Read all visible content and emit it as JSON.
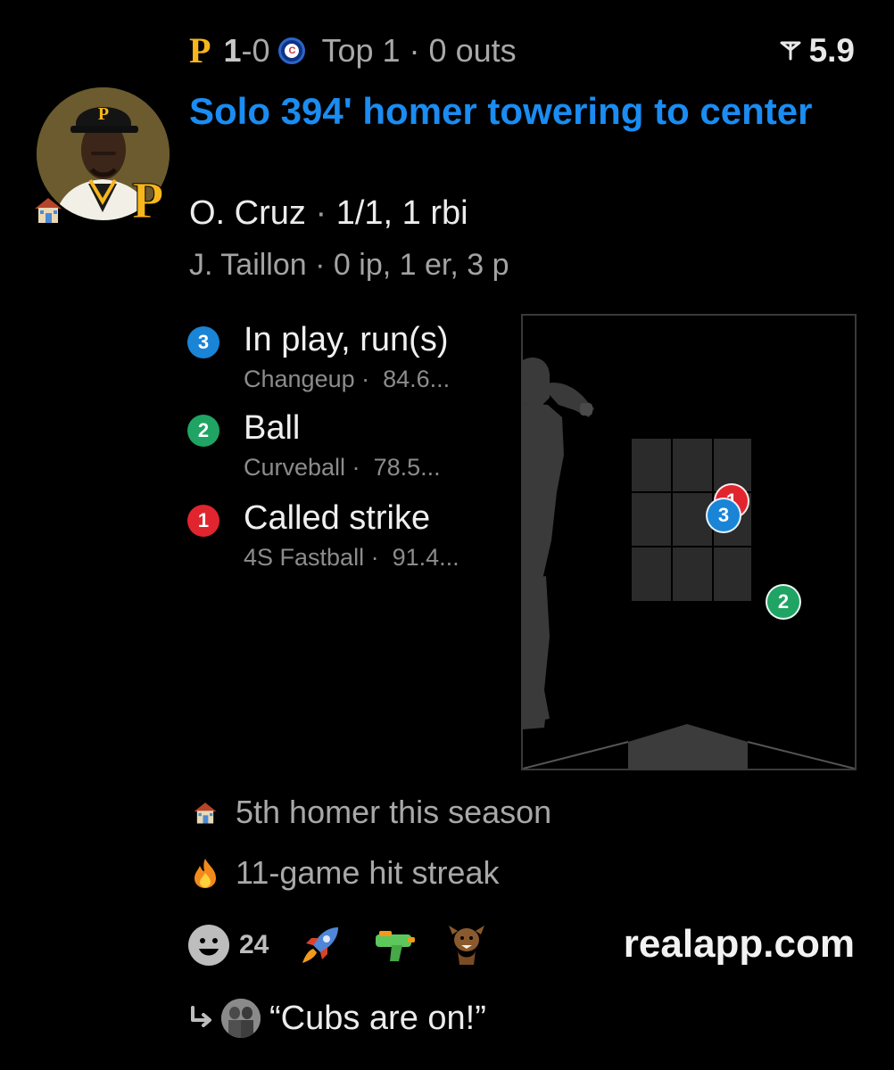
{
  "game": {
    "home_logo": "P",
    "home_score": "1",
    "away_score": "-0",
    "away_logo": "C",
    "inning_status": "Top 1 · 0 outs",
    "rating": "5.9",
    "rating_icon": "flag-icon"
  },
  "play": {
    "headline": "Solo 394' homer towering to center",
    "batter_name": "O. Cruz",
    "batter_stats": "1/1, 1 rbi",
    "pitcher_name": "J. Taillon",
    "pitcher_stats": "0 ip, 1 er, 3 p",
    "player_team_logo": "P"
  },
  "pitches": [
    {
      "number": "3",
      "result": "In play, run(s)",
      "pitch_type": "Changeup ·",
      "speed": "84.6...",
      "color": "#1a84d6"
    },
    {
      "number": "2",
      "result": "Ball",
      "pitch_type": "Curveball ·",
      "speed": "78.5...",
      "color": "#1fa463"
    },
    {
      "number": "1",
      "result": "Called strike",
      "pitch_type": "4S Fastball ·",
      "speed": "91.4...",
      "color": "#e0252e"
    }
  ],
  "facts": [
    {
      "icon": "house-icon",
      "text": "5th homer this season"
    },
    {
      "icon": "fire-icon",
      "text": "11-game hit streak"
    }
  ],
  "reactions": {
    "count": "24",
    "emojis": [
      "smiley-icon",
      "rocket-icon",
      "water-gun-icon",
      "wolverine-icon"
    ]
  },
  "brand": "realapp.com",
  "reply": {
    "text": "“Cubs are on!”"
  }
}
